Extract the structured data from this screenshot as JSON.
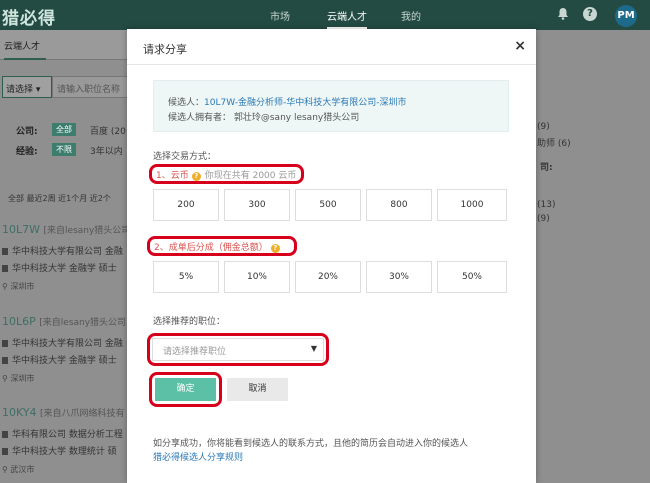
{
  "topbar": {
    "logo": "猎必得",
    "nav": [
      "市场",
      "云端人才",
      "我的"
    ],
    "active_nav_index": 1,
    "avatar_text": "PM",
    "icons": [
      "bell-icon",
      "help-icon"
    ]
  },
  "background": {
    "tab_label": "云端人才",
    "select_value": "请选择 ▾",
    "search_placeholder": "请输入职位名称",
    "company_label": "公司:",
    "company_chip": "全部",
    "company_value": "百度 (20",
    "experience_label": "经验:",
    "experience_chip": "不限",
    "experience_value": "3年以内",
    "time_filters": "全部  最近2周  近1个月  近2个",
    "candidates": [
      {
        "id": "10L7W",
        "source": "[来自lesany猎头公司",
        "line1": "华中科技大学有限公司 金融",
        "line2": "华中科技大学 金融学 硕士",
        "location": "深圳市"
      },
      {
        "id": "10L6P",
        "source": "[来自lesany猎头公司",
        "line1": "华中科技大学有限公司 金融",
        "line2": "华中科技大学 金融学 硕士",
        "location": "深圳市"
      },
      {
        "id": "10KY4",
        "source": "[来自八爪网络科技有",
        "line1": "华科有限公司 数据分析工程",
        "line2": "华中科技大学 数理统计 硕",
        "location": "武汉市"
      }
    ],
    "right_texts": [
      "(9)",
      "助师 (6)",
      "司:",
      "(13)",
      "(9)"
    ]
  },
  "modal": {
    "title": "请求分享",
    "close": "×",
    "candidate_prefix": "候选人：",
    "candidate_link": "10L7W-金融分析师-华中科技大学有限公司-深圳市",
    "owner_text": "候选人拥有者：  郭壮玲@sany lesany猎头公司",
    "trade_label": "选择交易方式：",
    "option1_title": "1、云币",
    "option1_hint": "你现在共有 2000 云币",
    "coin_options": [
      "200",
      "300",
      "500",
      "800",
      "1000"
    ],
    "option2_title": "2、成单后分成（佣金总额）",
    "percent_options": [
      "5%",
      "10%",
      "20%",
      "30%",
      "50%"
    ],
    "position_label": "选择推荐的职位：",
    "position_placeholder": "请选择推荐职位",
    "confirm": "确定",
    "cancel": "取消",
    "footer_note": "如分享成功，你将能看到候选人的联系方式，且他的简历会自动进入你的候选人",
    "footer_link": "猎必得候选人分享规则"
  }
}
